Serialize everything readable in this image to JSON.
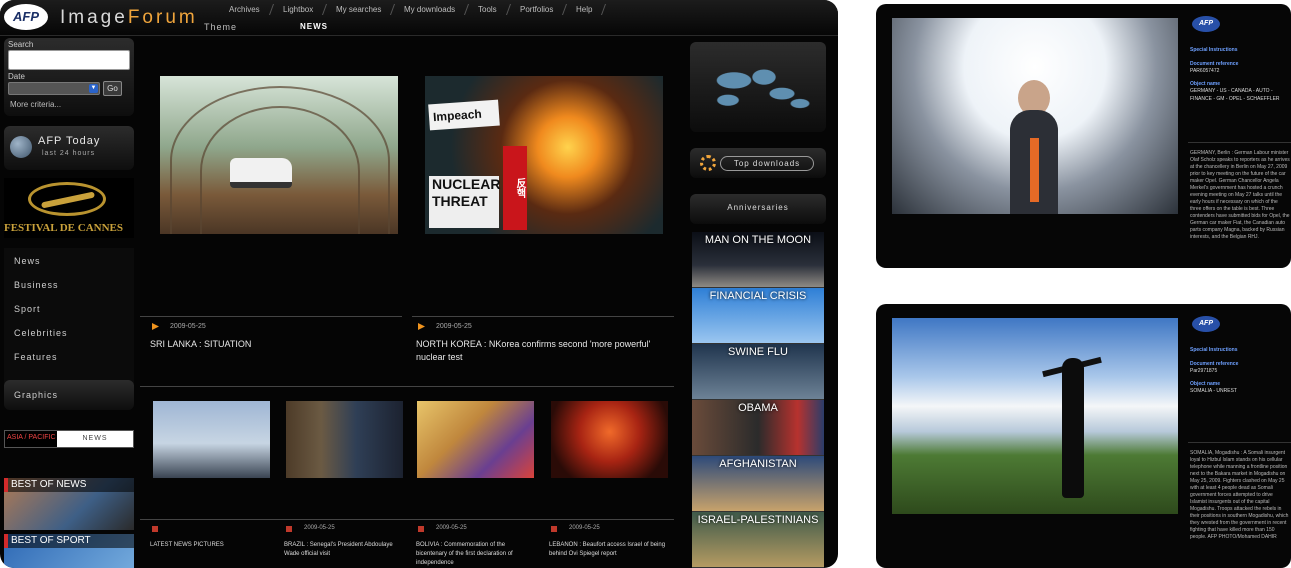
{
  "header": {
    "logo": "AFP",
    "brand_prefix": "Image",
    "brand_suffix": "Forum",
    "nav": [
      "Archives",
      "Lightbox",
      "My searches",
      "My downloads",
      "Tools",
      "Portfolios",
      "Help"
    ],
    "theme_tab": "Theme",
    "news_tab": "NEWS"
  },
  "sidebar": {
    "search_label": "Search",
    "search_value": "",
    "date_label": "Date",
    "go_label": "Go",
    "more_criteria": "More criteria...",
    "afp_today_title": "AFP Today",
    "afp_today_sub": "last 24 hours",
    "festival": "FESTIVAL DE CANNES",
    "menu": [
      "News",
      "Business",
      "Sport",
      "Celebrities",
      "Features"
    ],
    "graphics": "Graphics",
    "region": "ASIA / PACIFIC",
    "region_news": "NEWS",
    "best_news": "BEST OF NEWS",
    "best_sport": "BEST OF SPORT"
  },
  "main": {
    "stories": [
      {
        "date": "2009-05-25",
        "headline": "SRI LANKA : SITUATION"
      },
      {
        "date": "2009-05-25",
        "headline": "NORTH KOREA : NKorea confirms second 'more powerful' nuclear test"
      }
    ],
    "korea_signs": [
      "Impeach",
      "NUCLEAR THREAT",
      "反핵"
    ],
    "latest": [
      {
        "date": "",
        "text": "LATEST NEWS PICTURES"
      },
      {
        "date": "2009-05-25",
        "text": "BRAZIL : Senegal's President Abdoulaye Wade official visit"
      },
      {
        "date": "2009-05-25",
        "text": "BOLIVIA : Commemoration of the bicentenary of the first declaration of independence"
      },
      {
        "date": "2009-05-25",
        "text": "LEBANON : Beaufort access Israel of being behind Ovi Spiegel report"
      }
    ]
  },
  "right_sidebar": {
    "top_downloads": "Top downloads",
    "anniversaries": "Anniversaries",
    "items": [
      "MAN ON THE MOON",
      "FINANCIAL CRISIS",
      "SWINE FLU",
      "OBAMA",
      "AFGHANISTAN",
      "ISRAEL-PALESTINIANS"
    ]
  },
  "panels": [
    {
      "logo": "AFP",
      "special_instructions": "Special Instructions",
      "doc_ref_label": "Document reference",
      "doc_ref": "PAR6057472",
      "object_name_label": "Object name",
      "object_name": "GERMANY - US - CANADA - AUTO - FINANCE - GM - OPEL - SCHAEFFLER",
      "description": "GERMANY, Berlin : German Labour minister Olaf Scholz speaks to reporters as he arrives at the chancellery in Berlin on May 27, 2009 prior to key meeting on the future of the car maker Opel. German Chancellor Angela Merkel's government has hosted a crunch evening meeting on May 27 talks until the early hours if necessary on which of the three offers on the table is best. Three contenders have submitted bids for Opel, the German car maker Fiat, the Canadian auto parts company Magna, backed by Russian interests, and the Belgian RHJ."
    },
    {
      "logo": "AFP",
      "special_instructions": "Special Instructions",
      "doc_ref_label": "Document reference",
      "doc_ref": "Par2971875",
      "object_name_label": "Object name",
      "object_name": "SOMALIA - UNREST",
      "description": "SOMALIA, Mogadishu : A Somali insurgent loyal to Hizbul Islam stands on his cellular telephone while manning a frontline position next to the Bakara market in Mogadishu on May 25, 2009. Fighters clashed on May 25 with at least 4 people dead as Somali government forces attempted to drive Islamist insurgents out of the capital Mogadishu. Troops attacked the rebels in their positions in southern Mogadishu, which they wrested from the government in recent fighting that have killed more than 150 people. AFP PHOTO/Mohamed DAHIR"
    }
  ],
  "colors": {
    "accent_orange": "#f0a53c",
    "news_red": "#d32b2b",
    "gold": "#c9a13b"
  }
}
